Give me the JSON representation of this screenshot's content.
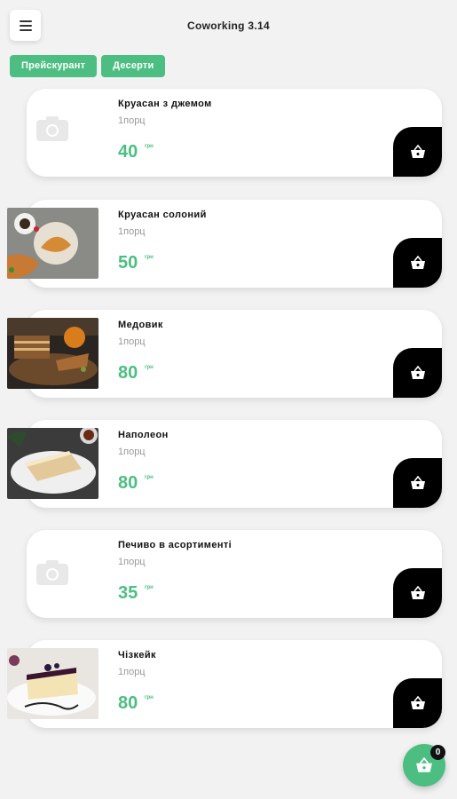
{
  "header": {
    "title": "Coworking 3.14"
  },
  "tabs": [
    {
      "label": "Прейскурант"
    },
    {
      "label": "Десерти"
    }
  ],
  "colors": {
    "accent": "#4cbe82",
    "cart_button": "#000000"
  },
  "products": [
    {
      "name": "Круасан з джемом",
      "portion": "1порц",
      "price": "40",
      "currency": "грн",
      "image": "placeholder-camera"
    },
    {
      "name": "Круасан солоний",
      "portion": "1порц",
      "price": "50",
      "currency": "грн",
      "image": "photo-croissant"
    },
    {
      "name": "Медовик",
      "portion": "1порц",
      "price": "80",
      "currency": "грн",
      "image": "photo-honey-cake"
    },
    {
      "name": "Наполеон",
      "portion": "1порц",
      "price": "80",
      "currency": "грн",
      "image": "photo-napoleon"
    },
    {
      "name": "Печиво в асортименті",
      "portion": "1порц",
      "price": "35",
      "currency": "грн",
      "image": "placeholder-camera"
    },
    {
      "name": "Чізкейк",
      "portion": "1порц",
      "price": "80",
      "currency": "грн",
      "image": "photo-cheesecake"
    }
  ],
  "cart": {
    "count": "0",
    "icon": "basket-icon"
  },
  "menu": {
    "icon": "hamburger-menu-icon"
  }
}
